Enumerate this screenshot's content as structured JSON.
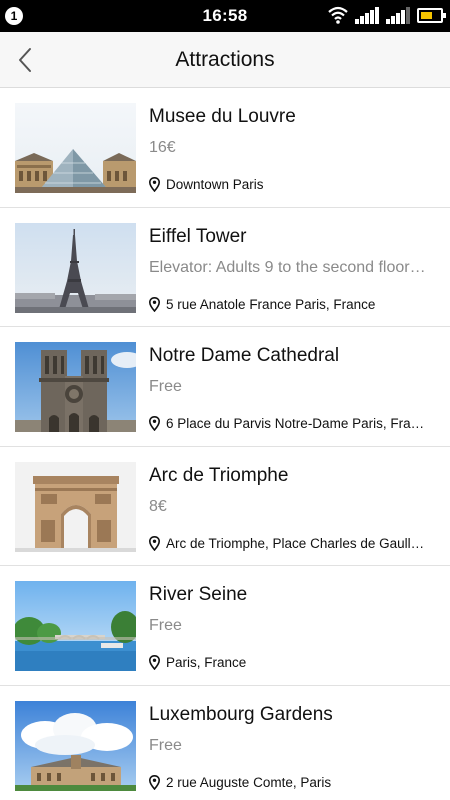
{
  "status_bar": {
    "notification_count": "1",
    "time": "16:58",
    "icons": [
      "wifi-icon",
      "signal-icon",
      "signal-icon",
      "battery-icon"
    ],
    "battery_color": "#f5c400"
  },
  "header": {
    "back_icon": "chevron-left-icon",
    "title": "Attractions"
  },
  "attractions": [
    {
      "name": "Musee du Louvre",
      "price": "16€",
      "address": "Downtown Paris"
    },
    {
      "name": "Eiffel Tower",
      "price": "Elevator: Adults 9 to the second floor…",
      "address": "5 rue Anatole France Paris, France"
    },
    {
      "name": "Notre Dame Cathedral",
      "price": "Free",
      "address": "6 Place du Parvis Notre-Dame Paris, Fra…"
    },
    {
      "name": "Arc de Triomphe",
      "price": "8€",
      "address": "Arc de Triomphe, Place Charles de Gaull…"
    },
    {
      "name": "River Seine",
      "price": "Free",
      "address": "Paris, France"
    },
    {
      "name": "Luxembourg Gardens",
      "price": "Free",
      "address": "2 rue Auguste Comte, Paris"
    }
  ],
  "colors": {
    "header_bg": "#f7f7f7",
    "price_text": "#8a8a8a",
    "divider": "#e1e1e1"
  }
}
